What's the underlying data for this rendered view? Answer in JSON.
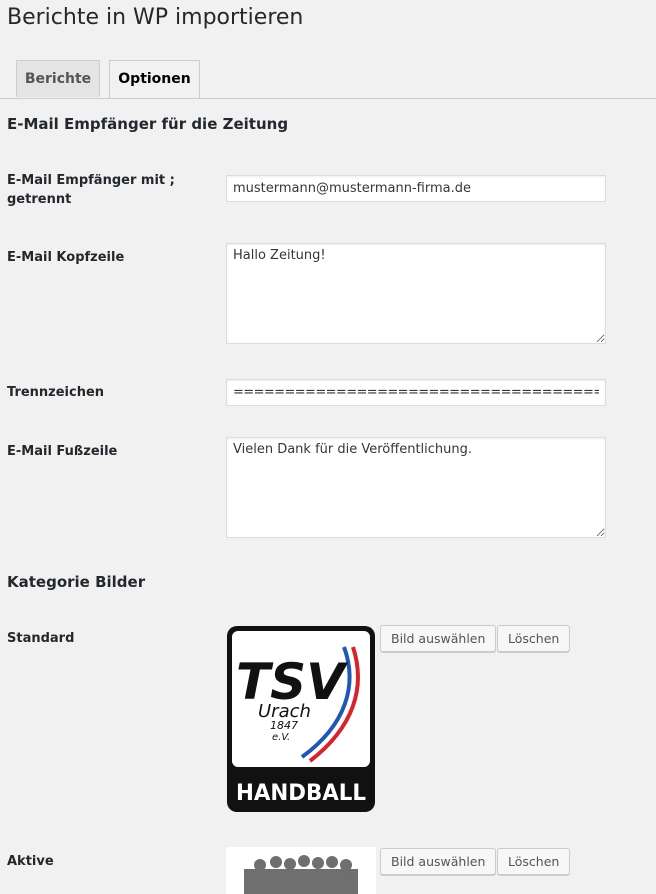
{
  "page": {
    "title": "Berichte in WP importieren"
  },
  "tabs": [
    {
      "label": "Berichte",
      "active": false
    },
    {
      "label": "Optionen",
      "active": true
    }
  ],
  "sections": {
    "email_title": "E-Mail Empfänger für die Zeitung",
    "images_title": "Kategorie Bilder"
  },
  "fields": {
    "recipients": {
      "label": "E-Mail Empfänger mit ; getrennt",
      "value": "mustermann@mustermann-firma.de"
    },
    "header": {
      "label": "E-Mail Kopfzeile",
      "value": "Hallo Zeitung!"
    },
    "separator": {
      "label": "Trennzeichen",
      "value": "===================================="
    },
    "footer": {
      "label": "E-Mail Fußzeile",
      "value": "Vielen Dank für die Veröffentlichung."
    }
  },
  "images": [
    {
      "label": "Standard",
      "logo": {
        "line1": "TSV",
        "line2": "Urach",
        "line3": "1847",
        "line4": "e.V.",
        "banner": "HANDBALL"
      },
      "select_label": "Bild auswählen",
      "delete_label": "Löschen"
    },
    {
      "label": "Aktive",
      "select_label": "Bild auswählen",
      "delete_label": "Löschen"
    }
  ],
  "colors": {
    "background": "#f1f1f1",
    "logo_red": "#d8232a",
    "logo_blue": "#1f57b8",
    "logo_black": "#111111"
  }
}
